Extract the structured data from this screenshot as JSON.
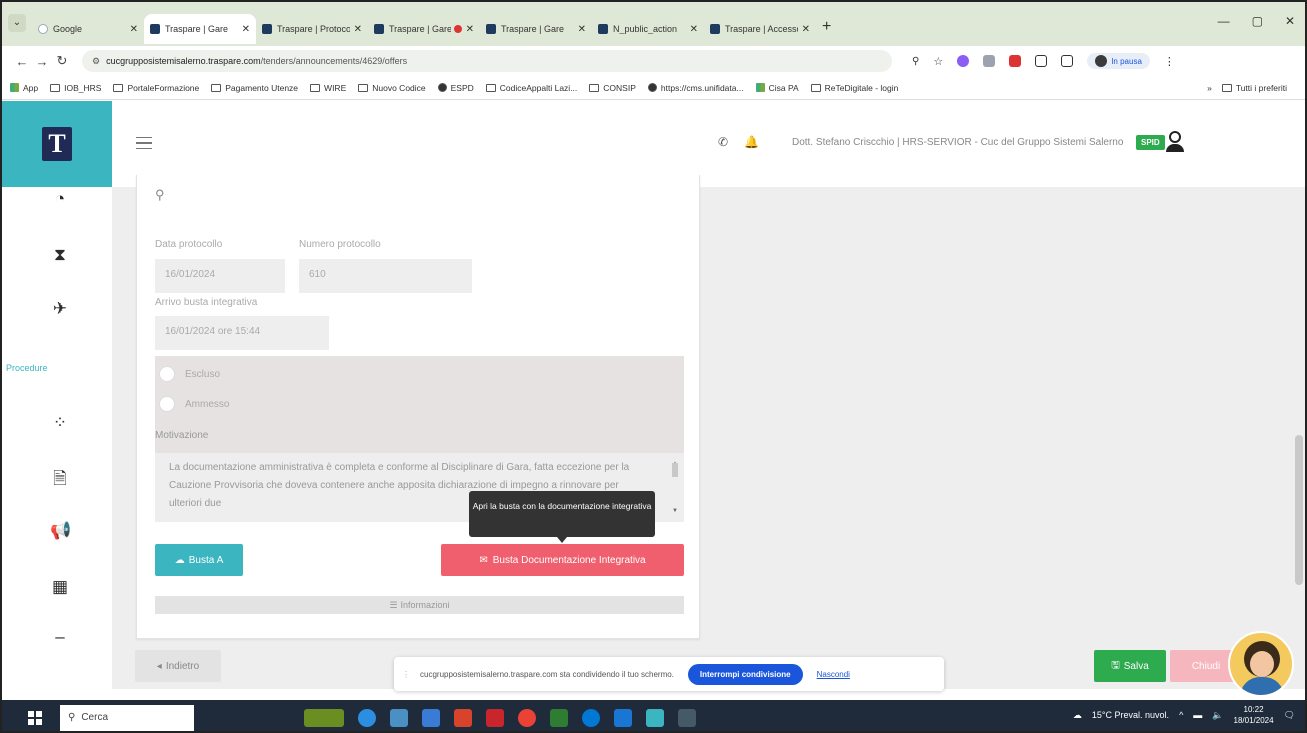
{
  "browser": {
    "tabs": [
      {
        "title": "Google",
        "active": false
      },
      {
        "title": "Traspare | Gare",
        "active": true
      },
      {
        "title": "Traspare | Protocollo",
        "active": false
      },
      {
        "title": "Traspare | Gare",
        "active": false,
        "recording": true
      },
      {
        "title": "Traspare | Gare",
        "active": false
      },
      {
        "title": "N_public_action",
        "active": false
      },
      {
        "title": "Traspare | Accesso",
        "active": false
      }
    ],
    "url_host": "cucgrupposistemisalerno.traspare.com",
    "url_path": "/tenders/announcements/4629/offers",
    "profile_label": "In pausa",
    "bookmarks": [
      "App",
      "IOB_HRS",
      "PortaleFormazione",
      "Pagamento Utenze",
      "WIRE",
      "Nuovo Codice",
      "ESPD",
      "CodiceAppalti Lazi...",
      "CONSIP",
      "https://cms.unifidata...",
      "Cisa PA",
      "ReTeDigitale - login"
    ],
    "bookmarks_right": "Tutti i preferiti"
  },
  "sidebar": {
    "active_label": "Procedure",
    "icons": [
      "dashboard-icon",
      "hourglass-icon",
      "send-icon",
      "spinner-icon",
      "document-icon",
      "megaphone-icon",
      "calculator-icon",
      "minus-icon"
    ]
  },
  "topbar": {
    "user": "Dott. Stefano Criscchio | HRS-SERVIOR - Cuc del Gruppo Sistemi Salerno",
    "badge": "SPID"
  },
  "form": {
    "data_protocollo_label": "Data protocollo",
    "data_protocollo_value": "16/01/2024",
    "numero_protocollo_label": "Numero protocollo",
    "numero_protocollo_value": "610",
    "arrivo_label": "Arrivo busta integrativa",
    "arrivo_value": "16/01/2024 ore 15:44",
    "radio_escluso": "Escluso",
    "radio_ammesso": "Ammesso",
    "motivazione_label": "Motivazione",
    "motivazione_text": "La documentazione amministrativa è completa e conforme al Disciplinare di Gara, fatta eccezione per la Cauzione Provvisoria che doveva contenere anche apposita dichiarazione di impegno a rinnovare per ulteriori due",
    "tooltip": "Apri la busta con la documentazione integrativa",
    "btn_busta_a": "Busta A",
    "btn_busta_doc": "Busta Documentazione Integrativa",
    "btn_info": "Informazioni"
  },
  "actions": {
    "back": "Indietro",
    "save": "Salva",
    "close": "Chiudi"
  },
  "sharebar": {
    "message": "cucgrupposistemisalerno.traspare.com sta condividendo il tuo schermo.",
    "stop": "Interrompi condivisione",
    "hide": "Nascondi"
  },
  "taskbar": {
    "search": "Cerca",
    "weather": "15°C Preval. nuvol.",
    "time": "10:22",
    "date": "18/01/2024"
  }
}
